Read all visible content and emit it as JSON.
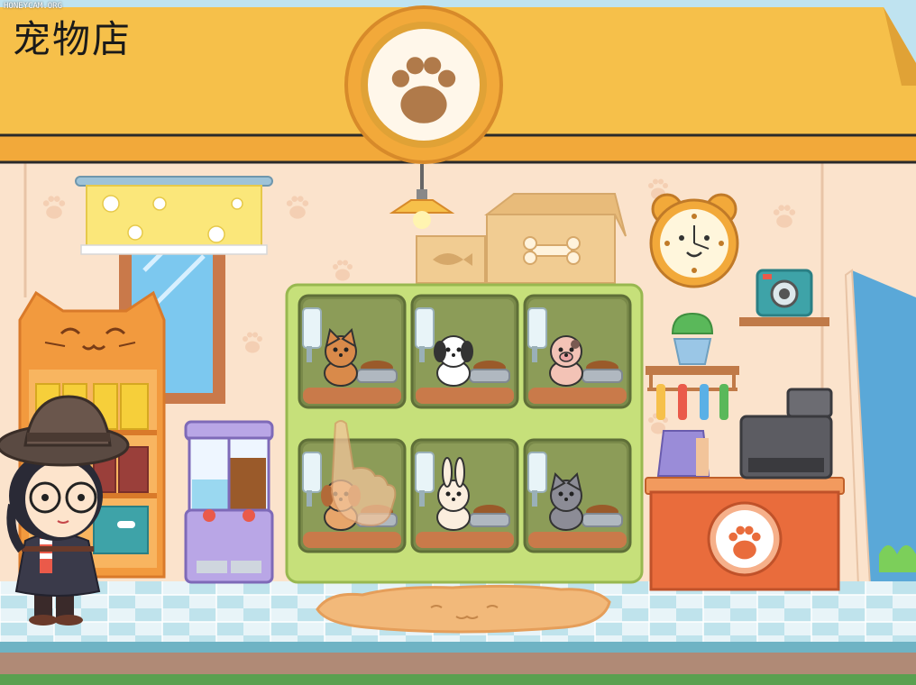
{
  "watermark": "HONEYCAM.ORG",
  "title": "宠物店",
  "colors": {
    "roof": "#f6c04a",
    "roof_dark": "#e0a236",
    "wall": "#fbe3cc",
    "wall_paw": "#f3cdb0",
    "cage_frame": "#c6e07a",
    "cage_inner": "#7a8a4a",
    "counter": "#e96c3c",
    "floor_tile_a": "#e8f4f8",
    "floor_tile_b": "#bfe3ec",
    "cabinet": "#f29a3e"
  },
  "icons": {
    "roof_sign": "paw-icon",
    "clock": "bear-clock-icon",
    "cabinet_top": "cat-face-icon",
    "counter_logo": "paw-icon",
    "rug": "cat-face-rug-icon",
    "hand_cursor": "pointing-hand-icon"
  },
  "cages": [
    {
      "pet": "shiba-dog",
      "label": "cage-1"
    },
    {
      "pet": "dalmatian-dog",
      "label": "cage-2"
    },
    {
      "pet": "spotted-pig",
      "label": "cage-3"
    },
    {
      "pet": "puppy",
      "label": "cage-4"
    },
    {
      "pet": "bunny",
      "label": "cage-5"
    },
    {
      "pet": "grey-cat",
      "label": "cage-6"
    }
  ]
}
